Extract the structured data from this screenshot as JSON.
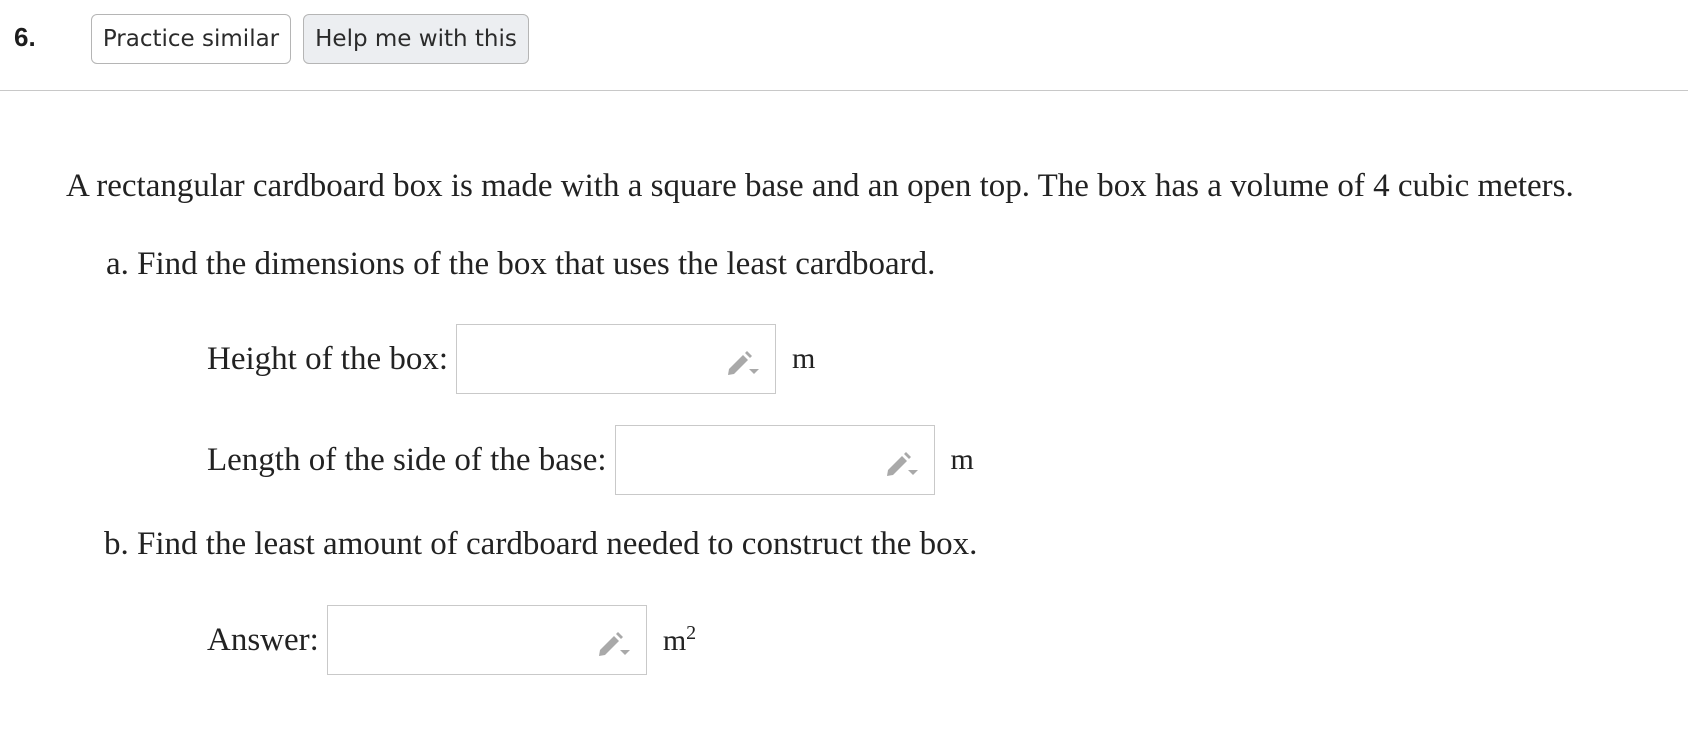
{
  "header": {
    "question_number": "6.",
    "practice_label": "Practice similar",
    "help_label": "Help me with this"
  },
  "problem": {
    "prompt_text": "A rectangular cardboard box is made with a square base and an open top. The box has a volume of ",
    "prompt_value": "4 cubic meters",
    "prompt_end": ".",
    "part_a": "a. Find the dimensions of the box that uses the least cardboard.",
    "part_b": "b. Find the least amount of cardboard needed to construct the box."
  },
  "fields": [
    {
      "label": "Height of the box:",
      "value": "",
      "unit": "m"
    },
    {
      "label": "Length of the side of the base:",
      "value": "",
      "unit": "m"
    },
    {
      "label": "Answer:",
      "value": "",
      "unit": "m",
      "unit_exponent": "2"
    }
  ],
  "icons": {
    "field_tool": "pencil-dropdown-icon"
  },
  "colors": {
    "help_button_bg": "#eceef1",
    "border": "#c9c9c9",
    "icon": "#a9a9a9"
  }
}
